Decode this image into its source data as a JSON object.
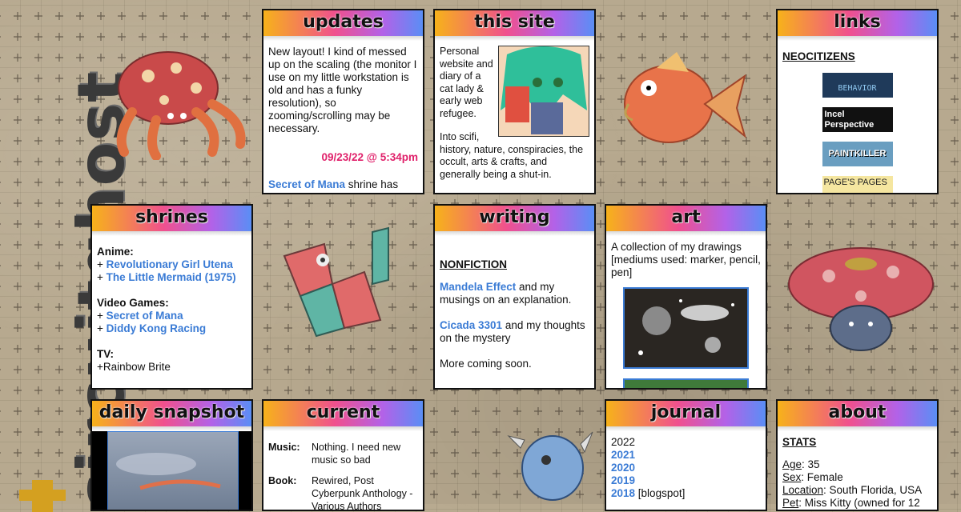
{
  "site": {
    "logo_text": "circuitghost"
  },
  "colors": {
    "link": "#3a7bd5",
    "timestamp": "#e0206a",
    "header_gradient": [
      "#f7b21a",
      "#f0508e",
      "#b262e8",
      "#5a8ef5"
    ]
  },
  "updates": {
    "title": "updates",
    "entry1": "New layout! I kind of messed up on the scaling (the monitor I use on my little workstation is old and has a funky resolution), so zooming/scrolling may be necessary.",
    "timestamp": "09/23/22 @ 5:34pm",
    "entry2_link": "Secret of Mana",
    "entry2_text": " shrine has been added and the remodel"
  },
  "this_site": {
    "title": "this site",
    "intro": "Personal website and diary of a cat lady & early web refugee.",
    "interests": "Into scifi, history, nature, conspiracies, the occult, arts & crafts, and generally being a shut-in."
  },
  "links": {
    "title": "links",
    "section": "NEOCITIZENS",
    "buttons": [
      "BEHAVIOR",
      "Incel Perspective",
      "PAINTKILLER",
      "PAGE'S PAGES"
    ]
  },
  "shrines": {
    "title": "shrines",
    "anime_label": "Anime:",
    "anime": [
      "Revolutionary Girl Utena",
      "The Little Mermaid (1975)"
    ],
    "games_label": "Video Games:",
    "games": [
      "Secret of Mana",
      "Diddy Kong Racing"
    ],
    "tv_label": "TV:",
    "tv": "+Rainbow Brite",
    "plus": "+ "
  },
  "writing": {
    "title": "writing",
    "section": "NONFICTION",
    "item1_link": "Mandela Effect",
    "item1_text": " and my musings on an explanation.",
    "item2_link": "Cicada 3301",
    "item2_text": " and my thoughts on the mystery",
    "more": "More coming soon."
  },
  "art": {
    "title": "art",
    "desc": "A collection of my drawings [mediums used: marker, pencil, pen]"
  },
  "daily": {
    "title": "daily snapshot"
  },
  "current": {
    "title": "current",
    "music_label": "Music:",
    "music": "Nothing. I need new music so bad",
    "book_label": "Book:",
    "book": "Rewired, Post Cyberpunk Anthology - Various Authors"
  },
  "journal": {
    "title": "journal",
    "years": [
      {
        "year": "2022",
        "link": false,
        "note": ""
      },
      {
        "year": "2021",
        "link": true,
        "note": ""
      },
      {
        "year": "2020",
        "link": true,
        "note": ""
      },
      {
        "year": "2019",
        "link": true,
        "note": ""
      },
      {
        "year": "2018",
        "link": true,
        "note": " [blogspot]"
      }
    ]
  },
  "about": {
    "title": "about",
    "section": "STATS",
    "rows": [
      {
        "label": "Age",
        "value": ": 35"
      },
      {
        "label": "Sex",
        "value": ": Female"
      },
      {
        "label": "Location",
        "value": ": South Florida, USA"
      },
      {
        "label": "Pet",
        "value": ": Miss Kitty (owned for 12"
      }
    ]
  }
}
